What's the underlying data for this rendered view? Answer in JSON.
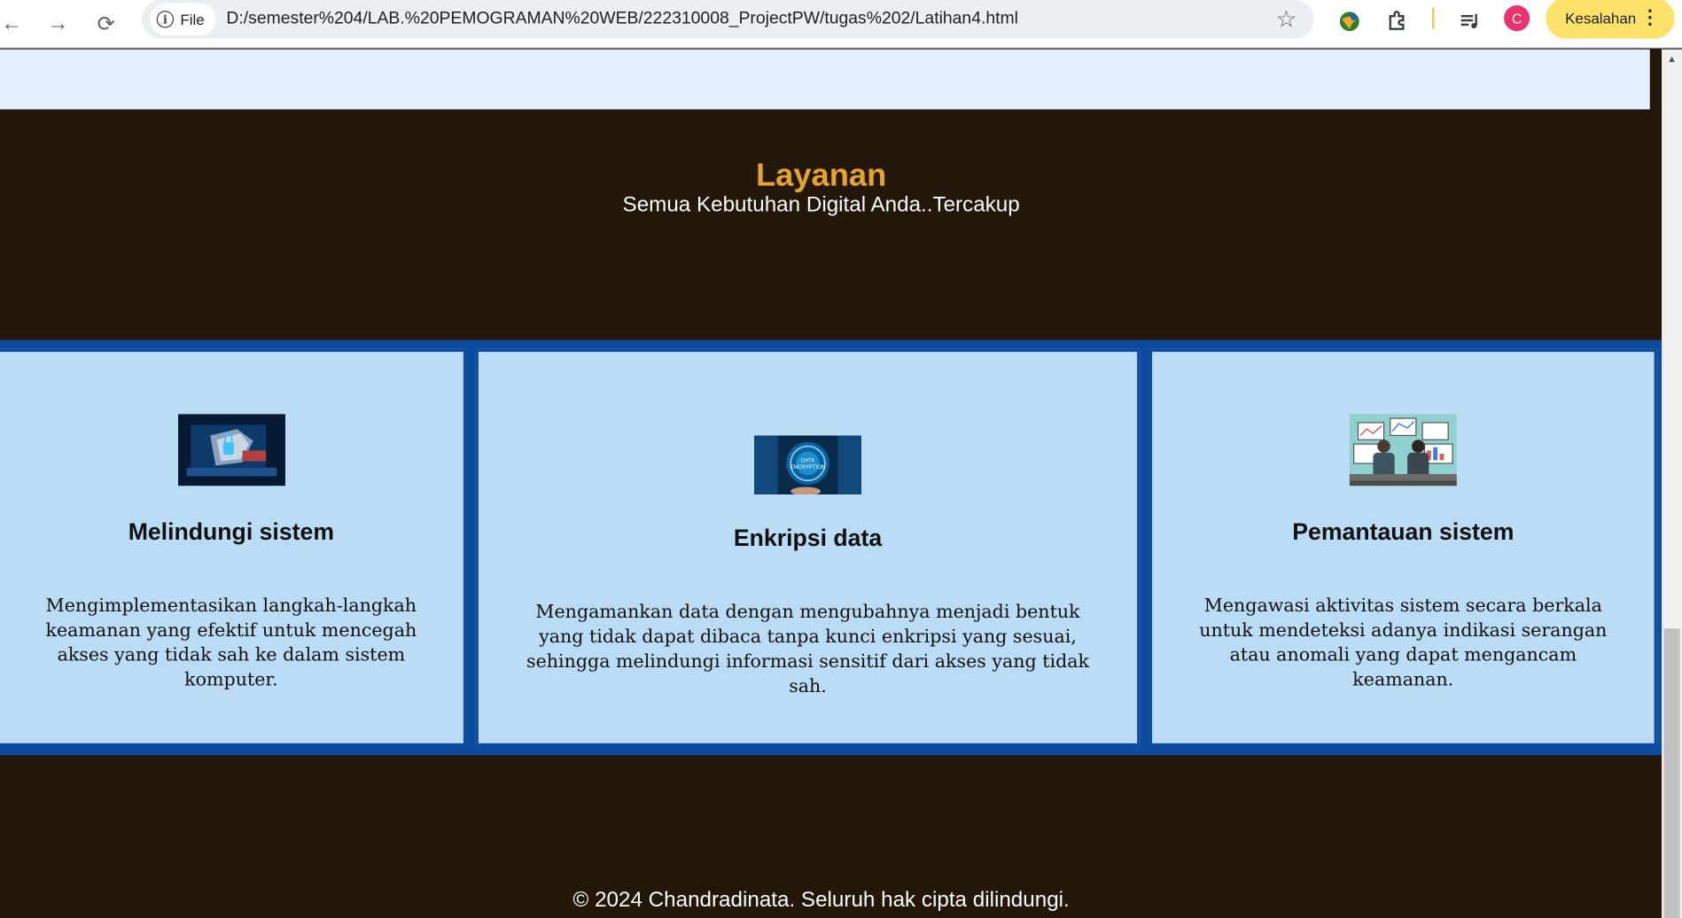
{
  "browser": {
    "site_chip": "File",
    "url": "D:/semester%204/LAB.%20PEMOGRAMAN%20WEB/222310008_ProjectPW/tugas%202/Latihan4.html",
    "profile_initial": "C",
    "error_chip": "Kesalahan"
  },
  "section": {
    "title": "Layanan",
    "subtitle": "Semua Kebutuhan Digital Anda..Tercakup"
  },
  "cards": [
    {
      "title": "Melindungi sistem",
      "description": "Mengimplementasikan langkah-langkah keamanan yang efektif untuk mencegah akses yang tidak sah ke dalam sistem komputer."
    },
    {
      "title": "Enkripsi data",
      "image_caption": "DATA ENCRYPTION",
      "description": "Mengamankan data dengan mengubahnya menjadi bentuk yang tidak dapat dibaca tanpa kunci enkripsi yang sesuai, sehingga melindungi informasi sensitif dari akses yang tidak sah."
    },
    {
      "title": "Pemantauan sistem",
      "description": "Mengawasi aktivitas sistem secara berkala untuk mendeteksi adanya indikasi serangan atau anomali yang dapat mengancam keamanan."
    }
  ],
  "footer": {
    "text": "© 2024 Chandradinata. Seluruh hak cipta dilindungi."
  }
}
